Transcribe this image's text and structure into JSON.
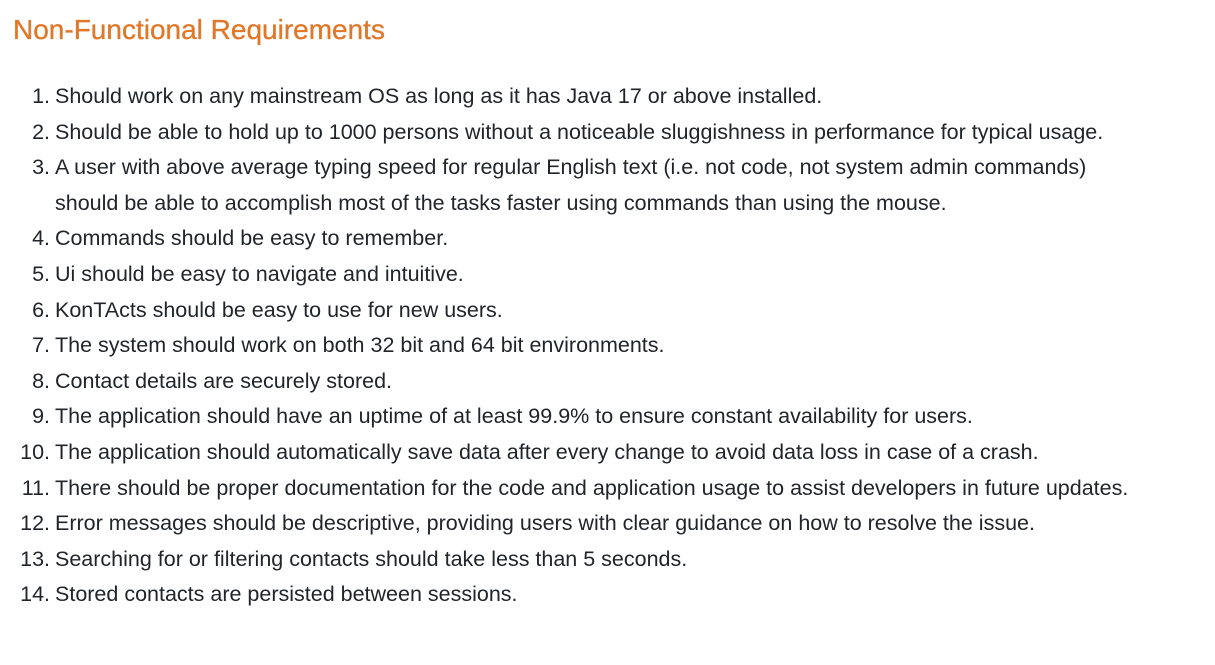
{
  "heading": "Non-Functional Requirements",
  "requirements": [
    {
      "number": "1.",
      "text": "Should work on any mainstream OS as long as it has Java 17 or above installed."
    },
    {
      "number": "2.",
      "text": "Should be able to hold up to 1000 persons without a noticeable sluggishness in performance for typical usage."
    },
    {
      "number": "3.",
      "text": "A user with above average typing speed for regular English text (i.e. not code, not system admin commands) should be able to accomplish most of the tasks faster using commands than using the mouse."
    },
    {
      "number": "4.",
      "text": "Commands should be easy to remember."
    },
    {
      "number": "5.",
      "text": "Ui should be easy to navigate and intuitive."
    },
    {
      "number": "6.",
      "text": "KonTActs should be easy to use for new users."
    },
    {
      "number": "7.",
      "text": "The system should work on both 32 bit and 64 bit environments."
    },
    {
      "number": "8.",
      "text": "Contact details are securely stored."
    },
    {
      "number": "9.",
      "text": "The application should have an uptime of at least 99.9% to ensure constant availability for users."
    },
    {
      "number": "10.",
      "text": "The application should automatically save data after every change to avoid data loss in case of a crash."
    },
    {
      "number": "11.",
      "text": "There should be proper documentation for the code and application usage to assist developers in future updates."
    },
    {
      "number": "12.",
      "text": "Error messages should be descriptive, providing users with clear guidance on how to resolve the issue."
    },
    {
      "number": "13.",
      "text": "Searching for or filtering contacts should take less than 5 seconds."
    },
    {
      "number": "14.",
      "text": "Stored contacts are persisted between sessions."
    }
  ]
}
